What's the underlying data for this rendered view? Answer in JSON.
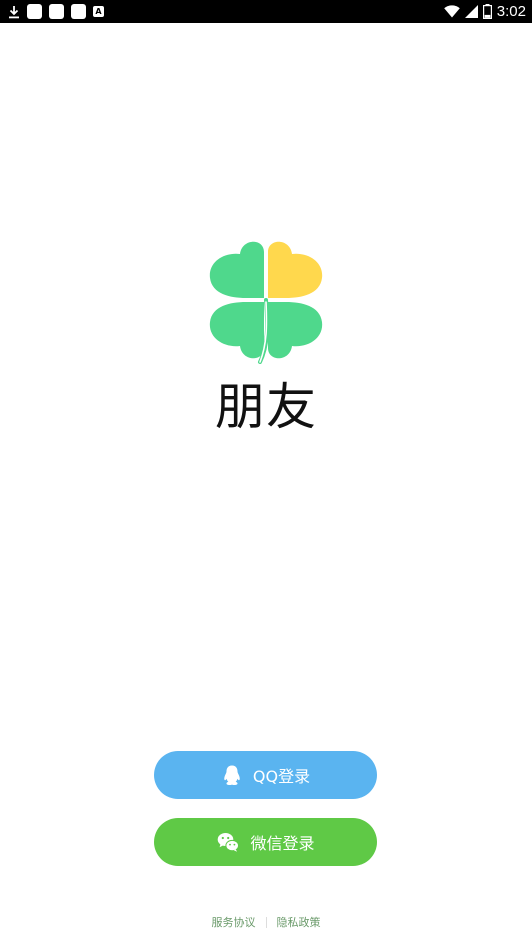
{
  "status_bar": {
    "time": "3:02",
    "battery_level": 0.25,
    "notification_icons": [
      "download-icon",
      "app-notification-icon",
      "app-notification-icon",
      "app-notification-icon",
      "a-notification-icon"
    ],
    "a_icon_letter": "A"
  },
  "app": {
    "name": "朋友",
    "logo_colors": [
      "#4fd88c",
      "#ffd84d"
    ]
  },
  "buttons": {
    "qq_label": "QQ登录",
    "wechat_label": "微信登录",
    "qq_color": "#5ab4f0",
    "wechat_color": "#5fc946"
  },
  "footer": {
    "terms_label": "服务协议",
    "privacy_label": "隐私政策"
  }
}
